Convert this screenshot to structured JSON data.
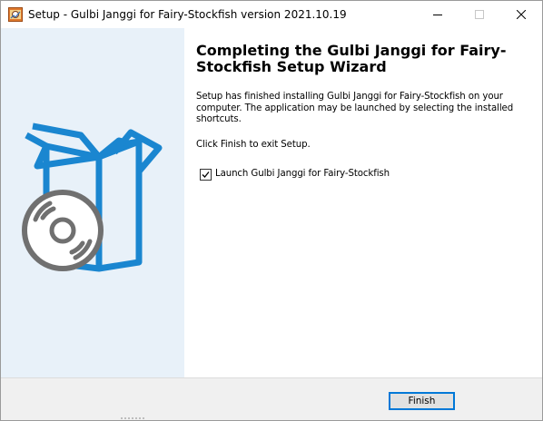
{
  "window": {
    "title": "Setup - Gulbi Janggi for Fairy-Stockfish version 2021.10.19",
    "icon": "setup-app-icon"
  },
  "caption_buttons": {
    "minimize_icon": "minimize-icon",
    "maximize_icon": "maximize-icon",
    "close_icon": "close-icon"
  },
  "wizard": {
    "heading": "Completing the Gulbi Janggi for Fairy-Stockfish Setup Wizard",
    "paragraph1": "Setup has finished installing Gulbi Janggi for Fairy-Stockfish on your computer. The application may be launched by selecting the installed shortcuts.",
    "paragraph2": "Click Finish to exit Setup.",
    "launch_checkbox": {
      "label": "Launch Gulbi Janggi for Fairy-Stockfish",
      "checked": true
    }
  },
  "footer": {
    "finish_label": "Finish"
  },
  "colors": {
    "side_panel": "#e8f1f9",
    "box_outline": "#1a86d0",
    "disc": "#707070",
    "button_focus": "#0078d7"
  }
}
